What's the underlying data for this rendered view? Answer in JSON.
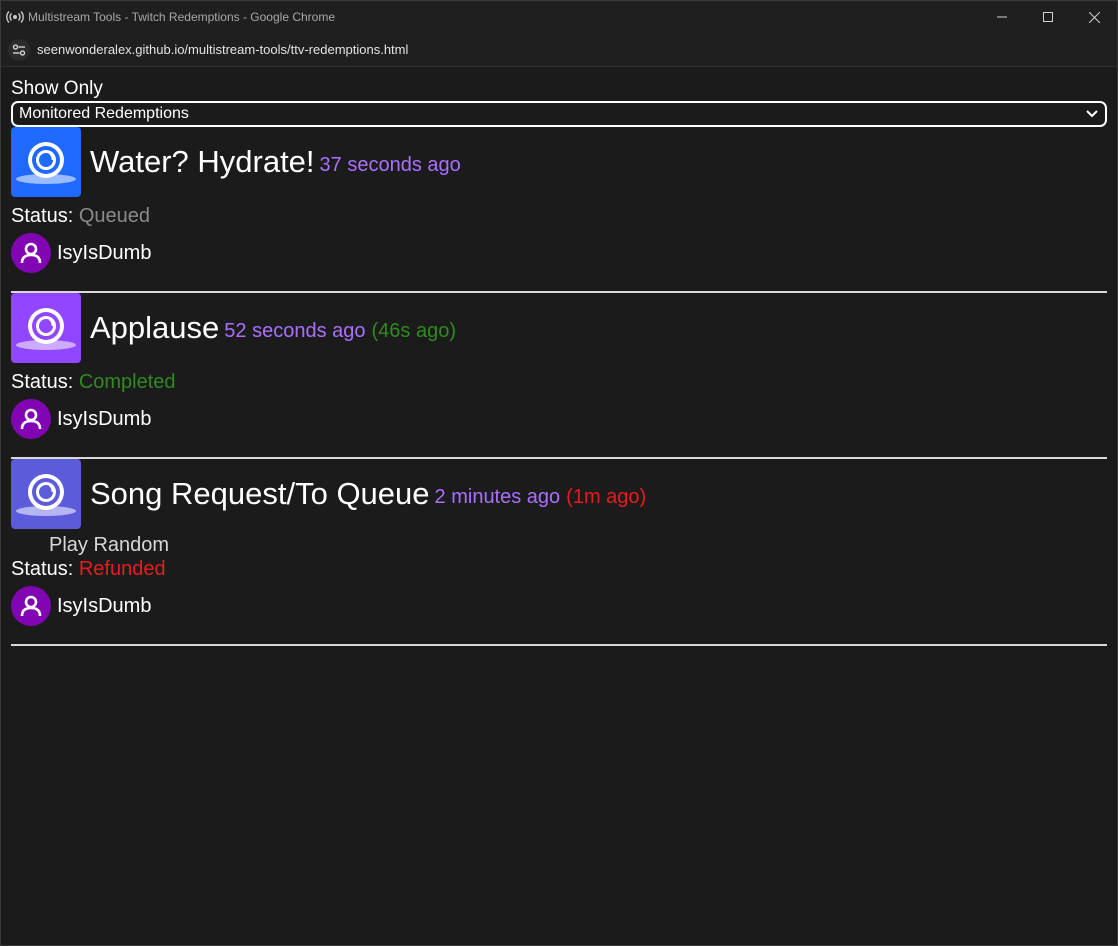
{
  "window": {
    "title": "Multistream Tools - Twitch Redemptions - Google Chrome",
    "url": "seenwonderalex.github.io/multistream-tools/ttv-redemptions.html"
  },
  "filter": {
    "label": "Show Only",
    "selected": "Monitored Redemptions"
  },
  "redemptions": [
    {
      "title": "Water? Hydrate!",
      "time_ago": "37 seconds ago",
      "elapsed": "",
      "user_input": "",
      "status_label": "Status:",
      "status": "Queued",
      "status_color": "#8a8a8a",
      "user": "IsyIsDumb",
      "icon_color": "#1f69ff",
      "icon": "reward-icon"
    },
    {
      "title": "Applause",
      "time_ago": "52 seconds ago",
      "elapsed": "(46s ago)",
      "elapsed_color": "#2e8b1e",
      "user_input": "",
      "status_label": "Status:",
      "status": "Completed",
      "status_color": "#2e8b1e",
      "user": "IsyIsDumb",
      "icon_color": "#9146ff",
      "icon": "reward-icon"
    },
    {
      "title": "Song Request/To Queue",
      "time_ago": "2 minutes ago",
      "elapsed": "(1m ago)",
      "elapsed_color": "#e81c1c",
      "user_input": "Play Random",
      "status_label": "Status:",
      "status": "Refunded",
      "status_color": "#e81c1c",
      "user": "IsyIsDumb",
      "icon_color": "#5c5cdb",
      "icon": "reward-icon"
    }
  ],
  "colors": {
    "time": "#a970ff",
    "avatar": "#8205b4"
  }
}
